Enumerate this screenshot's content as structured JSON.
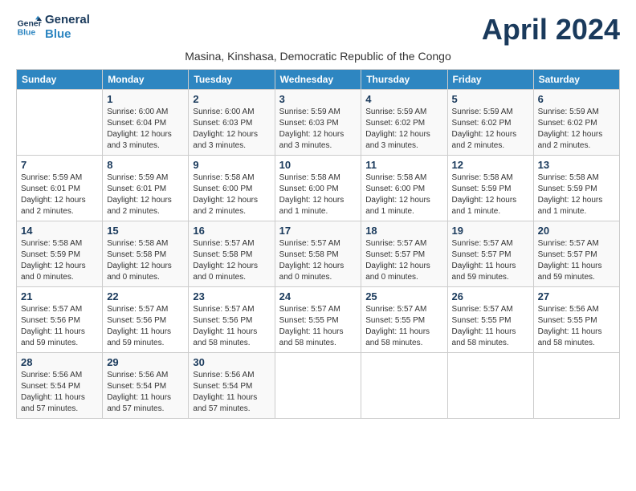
{
  "logo": {
    "line1": "General",
    "line2": "Blue"
  },
  "month_title": "April 2024",
  "subtitle": "Masina, Kinshasa, Democratic Republic of the Congo",
  "weekdays": [
    "Sunday",
    "Monday",
    "Tuesday",
    "Wednesday",
    "Thursday",
    "Friday",
    "Saturday"
  ],
  "weeks": [
    [
      {
        "day": "",
        "info": ""
      },
      {
        "day": "1",
        "info": "Sunrise: 6:00 AM\nSunset: 6:04 PM\nDaylight: 12 hours\nand 3 minutes."
      },
      {
        "day": "2",
        "info": "Sunrise: 6:00 AM\nSunset: 6:03 PM\nDaylight: 12 hours\nand 3 minutes."
      },
      {
        "day": "3",
        "info": "Sunrise: 5:59 AM\nSunset: 6:03 PM\nDaylight: 12 hours\nand 3 minutes."
      },
      {
        "day": "4",
        "info": "Sunrise: 5:59 AM\nSunset: 6:02 PM\nDaylight: 12 hours\nand 3 minutes."
      },
      {
        "day": "5",
        "info": "Sunrise: 5:59 AM\nSunset: 6:02 PM\nDaylight: 12 hours\nand 2 minutes."
      },
      {
        "day": "6",
        "info": "Sunrise: 5:59 AM\nSunset: 6:02 PM\nDaylight: 12 hours\nand 2 minutes."
      }
    ],
    [
      {
        "day": "7",
        "info": "Sunrise: 5:59 AM\nSunset: 6:01 PM\nDaylight: 12 hours\nand 2 minutes."
      },
      {
        "day": "8",
        "info": "Sunrise: 5:59 AM\nSunset: 6:01 PM\nDaylight: 12 hours\nand 2 minutes."
      },
      {
        "day": "9",
        "info": "Sunrise: 5:58 AM\nSunset: 6:00 PM\nDaylight: 12 hours\nand 2 minutes."
      },
      {
        "day": "10",
        "info": "Sunrise: 5:58 AM\nSunset: 6:00 PM\nDaylight: 12 hours\nand 1 minute."
      },
      {
        "day": "11",
        "info": "Sunrise: 5:58 AM\nSunset: 6:00 PM\nDaylight: 12 hours\nand 1 minute."
      },
      {
        "day": "12",
        "info": "Sunrise: 5:58 AM\nSunset: 5:59 PM\nDaylight: 12 hours\nand 1 minute."
      },
      {
        "day": "13",
        "info": "Sunrise: 5:58 AM\nSunset: 5:59 PM\nDaylight: 12 hours\nand 1 minute."
      }
    ],
    [
      {
        "day": "14",
        "info": "Sunrise: 5:58 AM\nSunset: 5:59 PM\nDaylight: 12 hours\nand 0 minutes."
      },
      {
        "day": "15",
        "info": "Sunrise: 5:58 AM\nSunset: 5:58 PM\nDaylight: 12 hours\nand 0 minutes."
      },
      {
        "day": "16",
        "info": "Sunrise: 5:57 AM\nSunset: 5:58 PM\nDaylight: 12 hours\nand 0 minutes."
      },
      {
        "day": "17",
        "info": "Sunrise: 5:57 AM\nSunset: 5:58 PM\nDaylight: 12 hours\nand 0 minutes."
      },
      {
        "day": "18",
        "info": "Sunrise: 5:57 AM\nSunset: 5:57 PM\nDaylight: 12 hours\nand 0 minutes."
      },
      {
        "day": "19",
        "info": "Sunrise: 5:57 AM\nSunset: 5:57 PM\nDaylight: 11 hours\nand 59 minutes."
      },
      {
        "day": "20",
        "info": "Sunrise: 5:57 AM\nSunset: 5:57 PM\nDaylight: 11 hours\nand 59 minutes."
      }
    ],
    [
      {
        "day": "21",
        "info": "Sunrise: 5:57 AM\nSunset: 5:56 PM\nDaylight: 11 hours\nand 59 minutes."
      },
      {
        "day": "22",
        "info": "Sunrise: 5:57 AM\nSunset: 5:56 PM\nDaylight: 11 hours\nand 59 minutes."
      },
      {
        "day": "23",
        "info": "Sunrise: 5:57 AM\nSunset: 5:56 PM\nDaylight: 11 hours\nand 58 minutes."
      },
      {
        "day": "24",
        "info": "Sunrise: 5:57 AM\nSunset: 5:55 PM\nDaylight: 11 hours\nand 58 minutes."
      },
      {
        "day": "25",
        "info": "Sunrise: 5:57 AM\nSunset: 5:55 PM\nDaylight: 11 hours\nand 58 minutes."
      },
      {
        "day": "26",
        "info": "Sunrise: 5:57 AM\nSunset: 5:55 PM\nDaylight: 11 hours\nand 58 minutes."
      },
      {
        "day": "27",
        "info": "Sunrise: 5:56 AM\nSunset: 5:55 PM\nDaylight: 11 hours\nand 58 minutes."
      }
    ],
    [
      {
        "day": "28",
        "info": "Sunrise: 5:56 AM\nSunset: 5:54 PM\nDaylight: 11 hours\nand 57 minutes."
      },
      {
        "day": "29",
        "info": "Sunrise: 5:56 AM\nSunset: 5:54 PM\nDaylight: 11 hours\nand 57 minutes."
      },
      {
        "day": "30",
        "info": "Sunrise: 5:56 AM\nSunset: 5:54 PM\nDaylight: 11 hours\nand 57 minutes."
      },
      {
        "day": "",
        "info": ""
      },
      {
        "day": "",
        "info": ""
      },
      {
        "day": "",
        "info": ""
      },
      {
        "day": "",
        "info": ""
      }
    ]
  ]
}
